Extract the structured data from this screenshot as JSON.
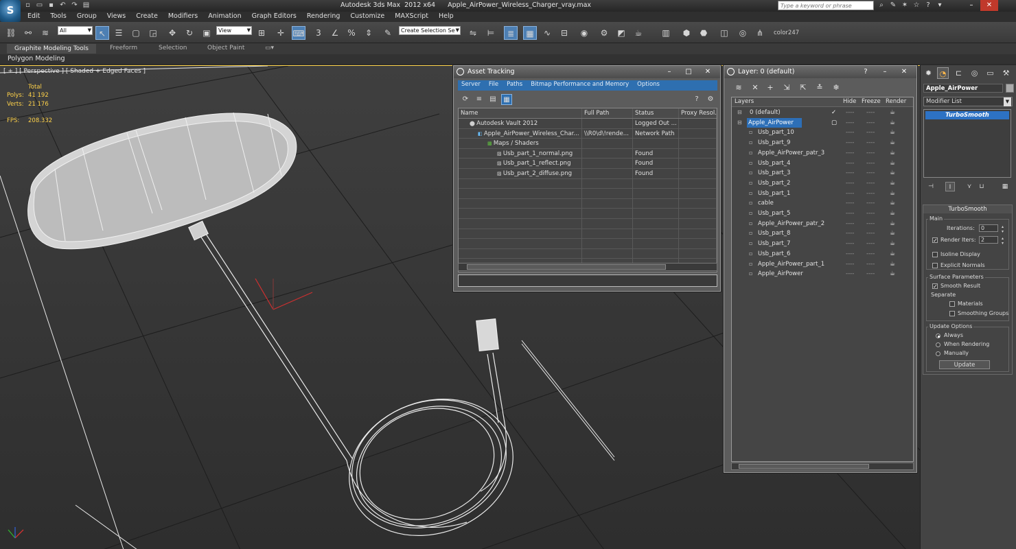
{
  "app": {
    "logo": "S",
    "title": "Autodesk 3ds Max  2012 x64      Apple_AirPower_Wireless_Charger_vray.max",
    "search_placeholder": "Type a keyword or phrase"
  },
  "menu": [
    "Edit",
    "Tools",
    "Group",
    "Views",
    "Create",
    "Modifiers",
    "Animation",
    "Graph Editors",
    "Rendering",
    "Customize",
    "MAXScript",
    "Help"
  ],
  "toolbar": {
    "selection_filter": "All",
    "reference_coord": "View",
    "named_selection": "Create Selection Se",
    "color_label": "color247"
  },
  "ribbon": {
    "tabs": [
      "Graphite Modeling Tools",
      "Freeform",
      "Selection",
      "Object Paint"
    ],
    "panel": "Polygon Modeling"
  },
  "viewport": {
    "label": "[ + ] [ Perspective ] [ Shaded + Edged Faces ]",
    "stats": {
      "total_label": "Total",
      "polys_label": "Polys:",
      "polys_value": "41 192",
      "verts_label": "Verts:",
      "verts_value": "21 176",
      "fps_label": "FPS:",
      "fps_value": "208.332"
    }
  },
  "asset_tracking": {
    "title": "Asset Tracking",
    "menu": [
      "Server",
      "File",
      "Paths",
      "Bitmap Performance and Memory",
      "Options"
    ],
    "columns": [
      "Name",
      "Full Path",
      "Status",
      "Proxy Resol."
    ],
    "rows": [
      {
        "name": "Autodesk Vault 2012",
        "path": "",
        "status": "Logged Out ...",
        "proxy": ""
      },
      {
        "name": "Apple_AirPower_Wireless_Char...",
        "path": "\\\\R0\\d\\!rende...",
        "status": "Network Path",
        "proxy": ""
      },
      {
        "name": "Maps / Shaders",
        "path": "",
        "status": "",
        "proxy": ""
      },
      {
        "name": "Usb_part_1_normal.png",
        "path": "",
        "status": "Found",
        "proxy": ""
      },
      {
        "name": "Usb_part_1_reflect.png",
        "path": "",
        "status": "Found",
        "proxy": ""
      },
      {
        "name": "Usb_part_2_diffuse.png",
        "path": "",
        "status": "Found",
        "proxy": ""
      }
    ]
  },
  "layers": {
    "title": "Layer: 0 (default)",
    "columns": [
      "Layers",
      "Hide",
      "Freeze",
      "Render"
    ],
    "items": [
      "0 (default)",
      "Apple_AirPower",
      "Usb_part_10",
      "Usb_part_9",
      "Apple_AirPower_patr_3",
      "Usb_part_4",
      "Usb_part_3",
      "Usb_part_2",
      "Usb_part_1",
      "cable",
      "Usb_part_5",
      "Apple_AirPower_patr_2",
      "Usb_part_8",
      "Usb_part_7",
      "Usb_part_6",
      "Apple_AirPower_part_1",
      "Apple_AirPower"
    ],
    "selected_index": 1,
    "checked_index": 0
  },
  "command_panel": {
    "object_name": "Apple_AirPower",
    "modifier_list": "Modifier List",
    "stack_item": "TurboSmooth",
    "rollout_title": "TurboSmooth",
    "main_group": "Main",
    "iterations_label": "Iterations:",
    "iterations_value": "0",
    "render_iters_label": "Render Iters:",
    "render_iters_value": "2",
    "render_iters_checked": true,
    "isoline_label": "Isoline Display",
    "explicit_normals_label": "Explicit Normals",
    "surface_group": "Surface Parameters",
    "smooth_result_label": "Smooth Result",
    "separate_label": "Separate",
    "materials_label": "Materials",
    "smoothing_groups_label": "Smoothing Groups",
    "update_group": "Update Options",
    "always_label": "Always",
    "when_rendering_label": "When Rendering",
    "manually_label": "Manually",
    "update_button": "Update"
  }
}
